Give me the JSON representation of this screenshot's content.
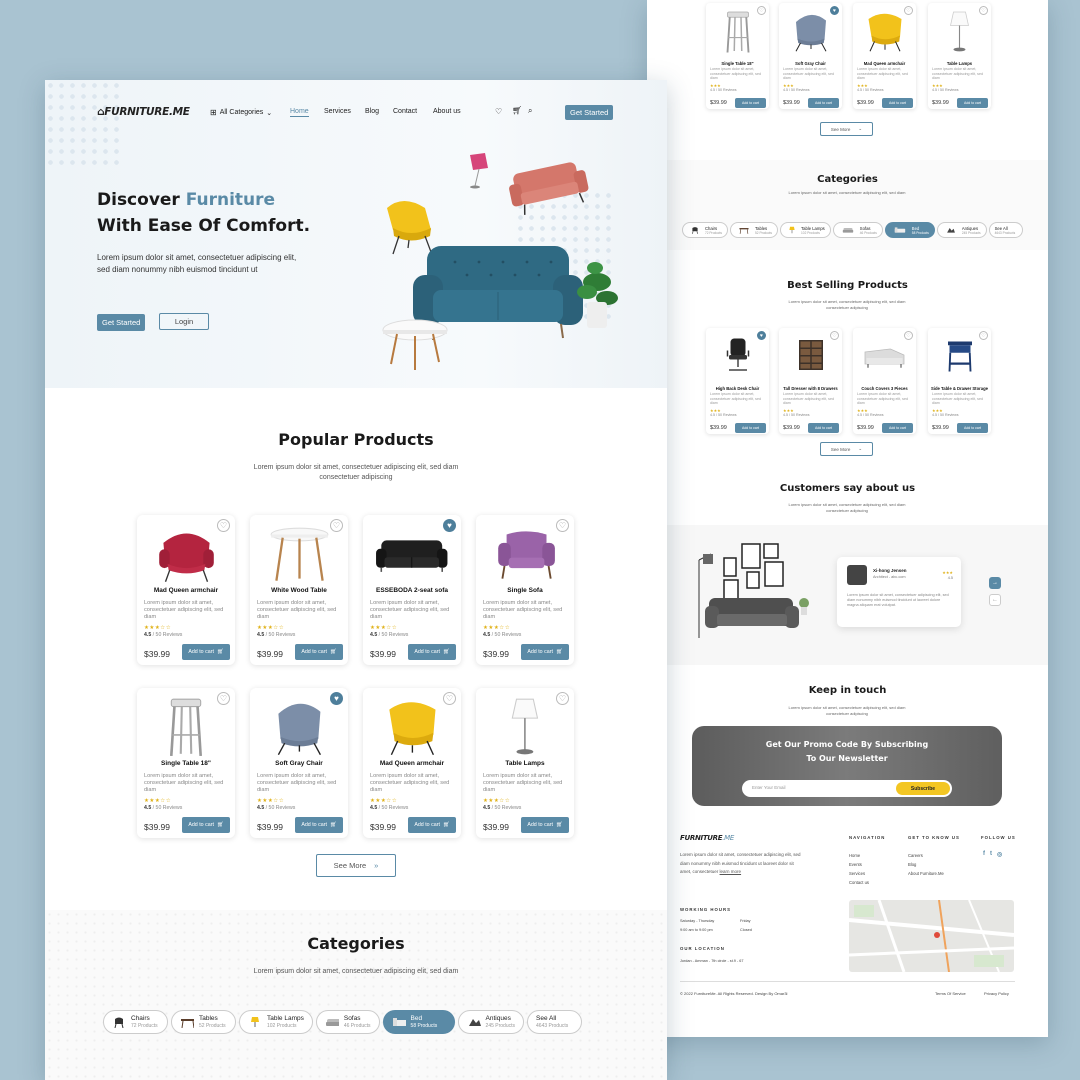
{
  "colors": {
    "accent": "#5a8aa6",
    "bg": "#a9c3d1",
    "star": "#e0b21a"
  },
  "brand": {
    "logo": "FURNITURE.ME"
  },
  "nav": {
    "categories": "All Categories",
    "items": [
      "Home",
      "Services",
      "Blog",
      "Contact",
      "About us"
    ],
    "get_started": "Get Started"
  },
  "hero": {
    "line1_a": "Discover",
    "line1_b": "Furniture",
    "line2": "With Ease Of Comfort.",
    "desc": "Lorem ipsum dolor sit amet, consectetuer adipiscing elit, sed diam nonummy nibh euismod tincidunt ut",
    "btn_primary": "Get Started",
    "btn_secondary": "Login"
  },
  "popular": {
    "title": "Popular Products",
    "subtitle": "Lorem ipsum dolor sit amet, consectetuer adipiscing elit, sed diam consectetuer adipiscing",
    "see_more": "See More",
    "products": [
      {
        "name": "Mad Queen armchair",
        "desc": "Lorem ipsum dolor sit amet, consectetuer adipiscing elit, sed diam",
        "stars": "★★★☆☆",
        "rating": "4.5",
        "reviews": "/ 50 Reviews",
        "price": "$39.99",
        "add": "Add to cart",
        "liked": false,
        "icon": "pink-armchair"
      },
      {
        "name": "White Wood Table",
        "desc": "Lorem ipsum dolor sit amet, consectetuer adipiscing elit, sed diam",
        "stars": "★★★☆☆",
        "rating": "4.5",
        "reviews": "/ 50 Reviews",
        "price": "$39.99",
        "add": "Add to cart",
        "liked": false,
        "icon": "round-table"
      },
      {
        "name": "ESSEBODA 2-seat sofa",
        "desc": "Lorem ipsum dolor sit amet, consectetuer adipiscing elit, sed diam",
        "stars": "★★★☆☆",
        "rating": "4.5",
        "reviews": "/ 50 Reviews",
        "price": "$39.99",
        "add": "Add to cart",
        "liked": true,
        "icon": "black-sofa"
      },
      {
        "name": "Single Sofa",
        "desc": "Lorem ipsum dolor sit amet, consectetuer adipiscing elit, sed diam",
        "stars": "★★★☆☆",
        "rating": "4.5",
        "reviews": "/ 50 Reviews",
        "price": "$39.99",
        "add": "Add to cart",
        "liked": false,
        "icon": "purple-chair"
      },
      {
        "name": "Single Table 18\"",
        "desc": "Lorem ipsum dolor sit amet, consectetuer adipiscing elit, sed diam",
        "stars": "★★★☆☆",
        "rating": "4.5",
        "reviews": "/ 50 Reviews",
        "price": "$39.99",
        "add": "Add to cart",
        "liked": false,
        "icon": "stool"
      },
      {
        "name": "Soft Gray Chair",
        "desc": "Lorem ipsum dolor sit amet, consectetuer adipiscing elit, sed diam",
        "stars": "★★★☆☆",
        "rating": "4.5",
        "reviews": "/ 50 Reviews",
        "price": "$39.99",
        "add": "Add to cart",
        "liked": true,
        "icon": "gray-chair"
      },
      {
        "name": "Mad Queen armchair",
        "desc": "Lorem ipsum dolor sit amet, consectetuer adipiscing elit, sed diam",
        "stars": "★★★☆☆",
        "rating": "4.5",
        "reviews": "/ 50 Reviews",
        "price": "$39.99",
        "add": "Add to cart",
        "liked": false,
        "icon": "yellow-chair"
      },
      {
        "name": "Table Lamps",
        "desc": "Lorem ipsum dolor sit amet, consectetuer adipiscing elit, sed diam",
        "stars": "★★★☆☆",
        "rating": "4.5",
        "reviews": "/ 50 Reviews",
        "price": "$39.99",
        "add": "Add to cart",
        "liked": false,
        "icon": "lamp"
      }
    ]
  },
  "categories": {
    "title": "Categories",
    "subtitle": "Lorem ipsum dolor sit amet, consectetuer adipiscing elit, sed diam",
    "items": [
      {
        "name": "Chairs",
        "count": "72 Products",
        "selected": false
      },
      {
        "name": "Tables",
        "count": "52 Products",
        "selected": false
      },
      {
        "name": "Table Lamps",
        "count": "102 Products",
        "selected": false
      },
      {
        "name": "Sofas",
        "count": "46 Products",
        "selected": false
      },
      {
        "name": "Bed",
        "count": "58 Products",
        "selected": true
      },
      {
        "name": "Antiques",
        "count": "245 Products",
        "selected": false
      },
      {
        "name": "See All",
        "count": "4643 Products",
        "selected": false
      }
    ]
  },
  "p2": {
    "top_products": [
      {
        "name": "Single Table 18\"",
        "price": "$39.99",
        "add": "Add to cart",
        "liked": false,
        "icon": "stool"
      },
      {
        "name": "Soft Gray Chair",
        "price": "$39.99",
        "add": "Add to cart",
        "liked": true,
        "icon": "gray-chair"
      },
      {
        "name": "Mad Queen armchair",
        "price": "$39.99",
        "add": "Add to cart",
        "liked": false,
        "icon": "yellow-chair"
      },
      {
        "name": "Table Lamps",
        "price": "$39.99",
        "add": "Add to cart",
        "liked": false,
        "icon": "lamp"
      }
    ],
    "see_more": "See More",
    "categories_title": "Categories",
    "best_title": "Best Selling Products",
    "best_sub": "Lorem ipsum dolor sit amet, consectetuer adipiscing elit, sed diam consectetuer adipiscing",
    "best_products": [
      {
        "name": "High Back Desk Chair",
        "price": "$39.99",
        "add": "Add to cart",
        "liked": true,
        "icon": "desk-chair"
      },
      {
        "name": "Tall Dresser with 8 Drawers",
        "price": "$39.99",
        "add": "Add to cart",
        "liked": false,
        "icon": "dresser"
      },
      {
        "name": "Couch Covers 3 Pieces",
        "price": "$39.99",
        "add": "Add to cart",
        "liked": false,
        "icon": "couch"
      },
      {
        "name": "Side Table & Drawer Storage",
        "price": "$39.99",
        "add": "Add to cart",
        "liked": false,
        "icon": "side-table"
      }
    ],
    "card_desc": "Lorem ipsum dolor sit amet, consectetuer adipiscing elit, sed diam",
    "card_rating": "4.5 / 50 Reviews",
    "testimonials_title": "Customers say about us",
    "testimonials_sub": "Lorem ipsum dolor sit amet, consectetuer adipiscing elit, sed diam consectetuer adipiscing",
    "reviewer": {
      "name": "Xi-hong Jensen",
      "role": "Architect - abc.com",
      "rating": "4.5",
      "text": "Lorem ipsum dolor sit amet, consectetuer adipiscing elit, sed diam nonummy nibh euismod tincidunt ut laoreet dolore magna aliquam erat volutpat."
    },
    "keep_title": "Keep in touch",
    "keep_sub": "Lorem ipsum dolor sit amet, consectetuer adipiscing elit, sed diam consectetuer adipiscing",
    "promo_l1": "Get Our Promo Code By Subscribing",
    "promo_l2": "To Our Newsletter",
    "email_placeholder": "Enter Your Email",
    "subscribe": "Subscribe",
    "footer": {
      "about": "Lorem ipsum dolor sit amet, consectetuer adipiscing elit, sed diam nonummy nibh euismod tincidunt ut laoreet dolor sit amet, consectetuer",
      "learn_more": "learn more",
      "hours_title": "WORKING HOURS",
      "hours_l1": "Saturday - Thursday",
      "hours_l2": "9:00 am to 9:00 pm",
      "hours_r1": "Friday",
      "hours_r2": "Closed",
      "loc_title": "OUR LOCATION",
      "loc": "Jordan - Amman - 7th circle - st.9 - 67",
      "nav_title": "NAVIGATION",
      "nav": [
        "Home",
        "Events",
        "Services",
        "Contact us"
      ],
      "know_title": "GET TO KNOW US",
      "know": [
        "Careers",
        "Blog",
        "About Furniture.Me"
      ],
      "follow_title": "FOLLOW US",
      "copyright": "© 2022 FurnitureMe. All Rights Reserved. Design By Omar3l",
      "terms": "Terms Of Service",
      "privacy": "Privacy Policy"
    }
  }
}
